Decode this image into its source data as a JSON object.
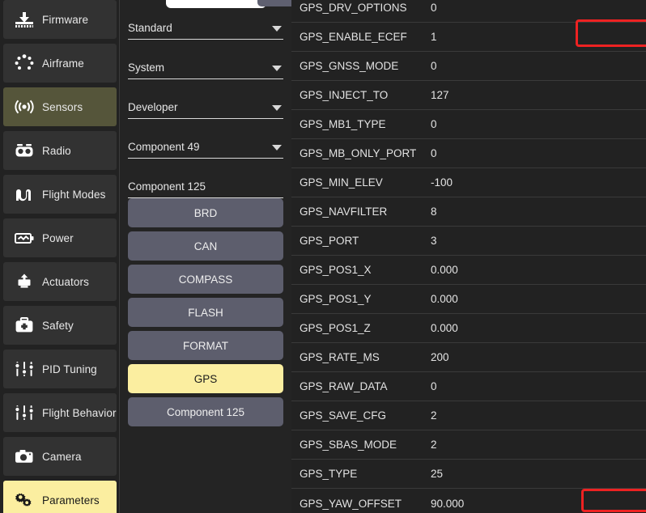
{
  "app": {
    "name": "QGroundControl Vehicle Setup",
    "background_color": "#222222",
    "accent_yellow": "#fbeea0",
    "accent_olive": "#55553a",
    "highlight_red": "#ee2222"
  },
  "sidebar": {
    "items": [
      {
        "label": "Firmware",
        "icon": "firmware-download-icon",
        "state": "normal"
      },
      {
        "label": "Airframe",
        "icon": "airframe-rotors-icon",
        "state": "normal"
      },
      {
        "label": "Sensors",
        "icon": "sensors-signal-icon",
        "state": "selected-olive"
      },
      {
        "label": "Radio",
        "icon": "radio-controller-icon",
        "state": "normal"
      },
      {
        "label": "Flight Modes",
        "icon": "flight-modes-wave-icon",
        "state": "normal"
      },
      {
        "label": "Power",
        "icon": "power-battery-icon",
        "state": "normal"
      },
      {
        "label": "Actuators",
        "icon": "actuators-motor-icon",
        "state": "normal"
      },
      {
        "label": "Safety",
        "icon": "safety-firstaid-icon",
        "state": "normal"
      },
      {
        "label": "PID Tuning",
        "icon": "sliders-icon",
        "state": "normal"
      },
      {
        "label": "Flight Behavior",
        "icon": "sliders-icon",
        "state": "normal"
      },
      {
        "label": "Camera",
        "icon": "camera-icon",
        "state": "normal"
      },
      {
        "label": "Parameters",
        "icon": "gears-icon",
        "state": "selected-yellow"
      }
    ]
  },
  "midcol": {
    "top_controls": {
      "search_pill": "",
      "tools_pill": ""
    },
    "dropdowns": [
      {
        "label": "Standard",
        "icon": "chevron-down-icon",
        "has_arrow": true
      },
      {
        "label": "System",
        "icon": "chevron-down-icon",
        "has_arrow": true
      },
      {
        "label": "Developer",
        "icon": "chevron-down-icon",
        "has_arrow": true
      },
      {
        "label": "Component 49",
        "icon": "chevron-down-icon",
        "has_arrow": true
      },
      {
        "label": "Component 125",
        "icon": "",
        "has_arrow": false
      }
    ],
    "group_buttons": [
      {
        "label": "BRD",
        "selected": false
      },
      {
        "label": "CAN",
        "selected": false
      },
      {
        "label": "COMPASS",
        "selected": false
      },
      {
        "label": "FLASH",
        "selected": false
      },
      {
        "label": "FORMAT",
        "selected": false
      },
      {
        "label": "GPS",
        "selected": true
      },
      {
        "label": "Component 125",
        "selected": false
      }
    ]
  },
  "params": {
    "rows": [
      {
        "name": "GPS_DRV_OPTIONS",
        "value": "0",
        "highlighted": false
      },
      {
        "name": "GPS_ENABLE_ECEF",
        "value": "1",
        "highlighted": true
      },
      {
        "name": "GPS_GNSS_MODE",
        "value": "0",
        "highlighted": false
      },
      {
        "name": "GPS_INJECT_TO",
        "value": "127",
        "highlighted": false
      },
      {
        "name": "GPS_MB1_TYPE",
        "value": "0",
        "highlighted": false
      },
      {
        "name": "GPS_MB_ONLY_PORT",
        "value": "0",
        "highlighted": false
      },
      {
        "name": "GPS_MIN_ELEV",
        "value": "-100",
        "highlighted": false
      },
      {
        "name": "GPS_NAVFILTER",
        "value": "8",
        "highlighted": false
      },
      {
        "name": "GPS_PORT",
        "value": "3",
        "highlighted": false
      },
      {
        "name": "GPS_POS1_X",
        "value": "0.000",
        "highlighted": false
      },
      {
        "name": "GPS_POS1_Y",
        "value": "0.000",
        "highlighted": false
      },
      {
        "name": "GPS_POS1_Z",
        "value": "0.000",
        "highlighted": false
      },
      {
        "name": "GPS_RATE_MS",
        "value": "200",
        "highlighted": false
      },
      {
        "name": "GPS_RAW_DATA",
        "value": "0",
        "highlighted": false
      },
      {
        "name": "GPS_SAVE_CFG",
        "value": "2",
        "highlighted": false
      },
      {
        "name": "GPS_SBAS_MODE",
        "value": "2",
        "highlighted": false
      },
      {
        "name": "GPS_TYPE",
        "value": "25",
        "highlighted": false
      },
      {
        "name": "GPS_YAW_OFFSET",
        "value": "90.000",
        "highlighted": true
      }
    ]
  }
}
